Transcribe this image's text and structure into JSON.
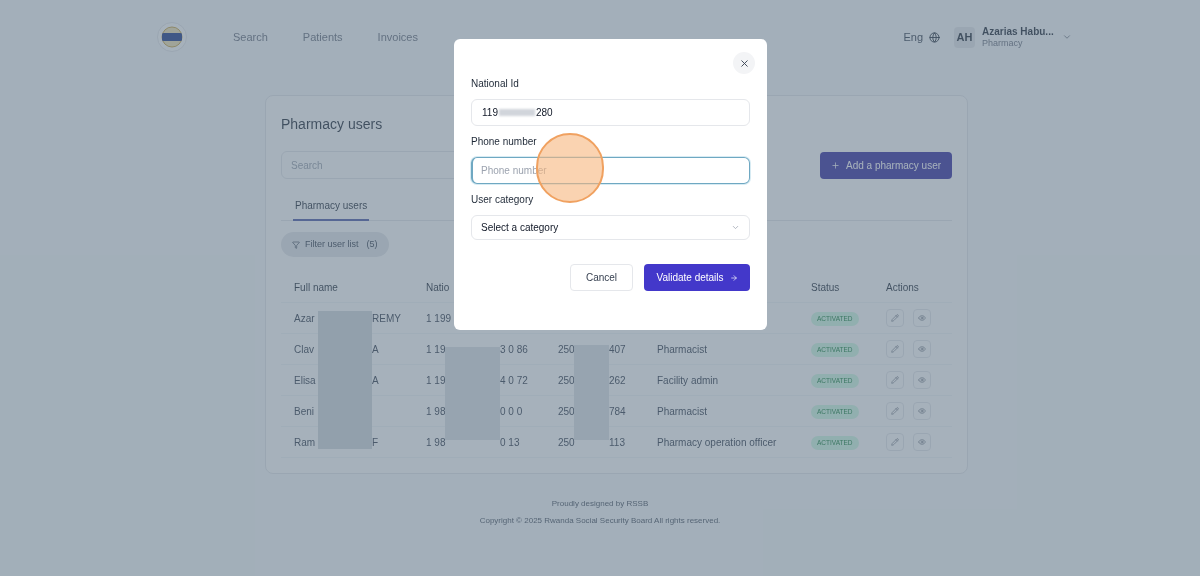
{
  "header": {
    "nav": [
      {
        "label": "Search"
      },
      {
        "label": "Patients"
      },
      {
        "label": "Invoices"
      }
    ],
    "language": "Eng",
    "user": {
      "initials": "AH",
      "name": "Azarias Habu...",
      "role": "Pharmacy"
    }
  },
  "card": {
    "title": "Pharmacy users",
    "search": {
      "placeholder": "Search"
    },
    "add_button": "Add a pharmacy user",
    "tabs": [
      {
        "label": "Pharmacy users",
        "selected": true
      }
    ],
    "filter": {
      "label": "Filter user list",
      "count": "(5)"
    }
  },
  "table": {
    "header": {
      "full_name": "Full name",
      "national_id": "Natio",
      "status": "Status",
      "actions": "Actions"
    },
    "rows": [
      {
        "name": [
          "Azar",
          "REMY"
        ],
        "national_id": [
          "1 199"
        ],
        "status": "ACTIVATED"
      },
      {
        "name": [
          "Clav",
          "A"
        ],
        "national_id": [
          "1 19",
          "3 0 86"
        ],
        "phone": [
          "250",
          "407"
        ],
        "role": "Pharmacist",
        "status": "ACTIVATED"
      },
      {
        "name": [
          "Elisa",
          "A"
        ],
        "national_id": [
          "1 19",
          "4 0 72"
        ],
        "phone": [
          "250",
          "262"
        ],
        "role": "Facility admin",
        "status": "ACTIVATED"
      },
      {
        "name": [
          "Beni"
        ],
        "national_id": [
          "1 98",
          "0 0 0"
        ],
        "phone": [
          "250",
          "784"
        ],
        "role": "Pharmacist",
        "status": "ACTIVATED"
      },
      {
        "name": [
          "Ram",
          "F"
        ],
        "national_id": [
          "1 98",
          "0 13"
        ],
        "phone": [
          "250",
          "113"
        ],
        "role": "Pharmacy operation officer",
        "status": "ACTIVATED"
      }
    ]
  },
  "footer": {
    "lines": [
      "Proudly designed by RSSB",
      "Copyright © 2025 Rwanda Social Security Board All rights reserved."
    ]
  },
  "modal": {
    "fields": [
      {
        "kind": "text",
        "label": "National Id",
        "value": [
          "119",
          "280"
        ]
      },
      {
        "kind": "input",
        "label": "Phone number",
        "placeholder": "Phone number",
        "focused": true
      },
      {
        "kind": "select",
        "label": "User category",
        "placeholder": "Select a category"
      }
    ],
    "cancel": "Cancel",
    "submit": "Validate details"
  }
}
